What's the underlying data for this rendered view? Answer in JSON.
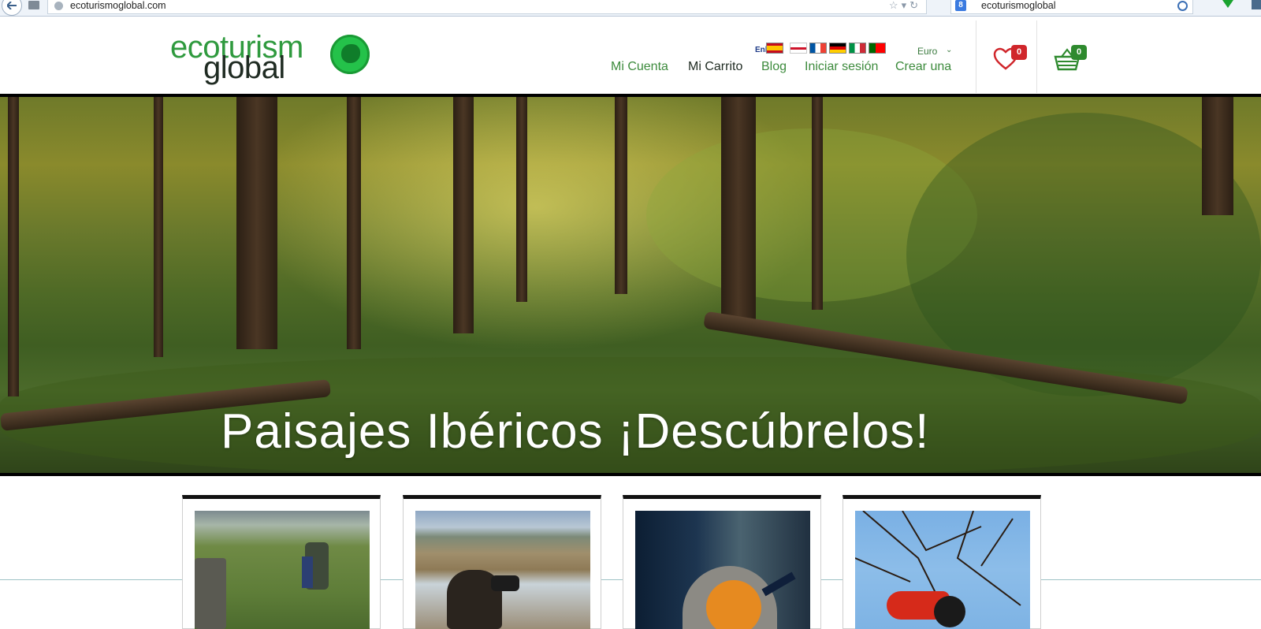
{
  "browser": {
    "url": "ecoturismoglobal.com",
    "search_query": "ecoturismoglobal",
    "search_engine": "8"
  },
  "logo": {
    "line1": "ecoturism",
    "line2": "global"
  },
  "languages": {
    "current_label": "Enlis",
    "flags": [
      "es",
      "gb",
      "fr",
      "de",
      "it",
      "pt"
    ]
  },
  "currency": {
    "selected": "Euro",
    "chevron": "⌄"
  },
  "nav": {
    "mi_cuenta": "Mi Cuenta",
    "mi_carrito": "Mi Carrito",
    "blog": "Blog",
    "iniciar_sesion": "Iniciar sesión",
    "crear_una": "Crear una"
  },
  "wishlist": {
    "count": "0",
    "icon": "heart-icon"
  },
  "cart": {
    "count": "0",
    "icon": "basket-icon"
  },
  "hero": {
    "title": "Paisajes Ibéricos ¡Descúbrelos!"
  },
  "products": [
    {
      "image": "hiker-in-meadow"
    },
    {
      "image": "birdwatcher-with-binoculars"
    },
    {
      "image": "robin-bird"
    },
    {
      "image": "toucan-in-branches"
    }
  ],
  "colors": {
    "brand_green": "#2f9a3e",
    "nav_green": "#3d8b3d",
    "badge_red": "#d0262b",
    "badge_green": "#2e8a2e"
  }
}
